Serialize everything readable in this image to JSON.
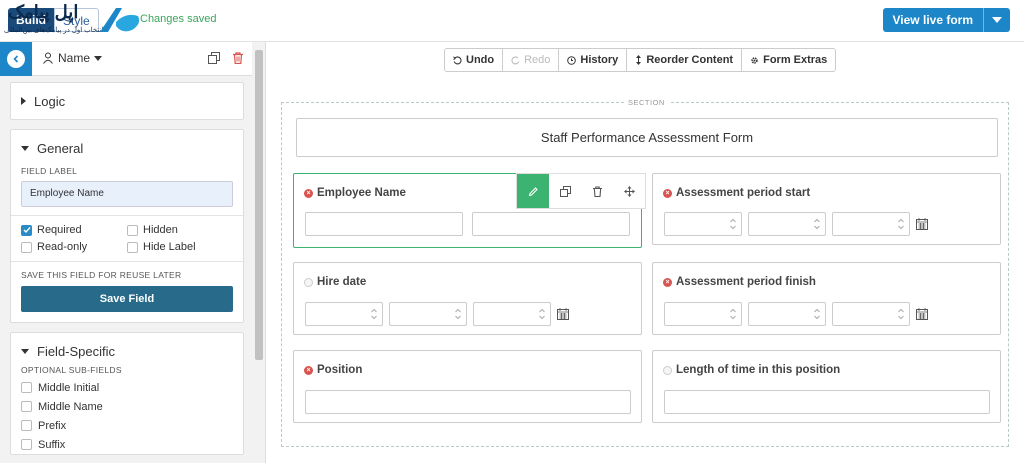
{
  "topbar": {
    "build_label": "Build",
    "style_label": "Style",
    "saved_text": "Changes saved",
    "watermark_text": "اپل پیامک",
    "watermark_subtext": "انتخاب اول در پیامک‌های بین‌المللی",
    "view_live_label": "View live form"
  },
  "panel": {
    "field_name_label": "Name",
    "logic_title": "Logic",
    "general_title": "General",
    "field_label_caption": "FIELD LABEL",
    "field_label_value": "Employee Name",
    "checks": [
      {
        "label": "Required",
        "checked": true
      },
      {
        "label": "Hidden",
        "checked": false
      },
      {
        "label": "Read-only",
        "checked": false
      },
      {
        "label": "Hide Label",
        "checked": false
      }
    ],
    "save_caption": "SAVE THIS FIELD FOR REUSE LATER",
    "save_button": "Save Field",
    "field_specific_title": "Field-Specific",
    "optional_caption": "OPTIONAL SUB-FIELDS",
    "subfields": [
      "Middle Initial",
      "Middle Name",
      "Prefix",
      "Suffix"
    ]
  },
  "toolbar": {
    "undo": "Undo",
    "redo": "Redo",
    "history": "History",
    "reorder": "Reorder Content",
    "extras": "Form Extras"
  },
  "form": {
    "section_label": "SECTION",
    "title": "Staff Performance Assessment Form",
    "fields": {
      "employee_name": {
        "label": "Employee Name",
        "required": true
      },
      "period_start": {
        "label": "Assessment period start",
        "required": true
      },
      "hire_date": {
        "label": "Hire date",
        "required": false
      },
      "period_finish": {
        "label": "Assessment period finish",
        "required": true
      },
      "position": {
        "label": "Position",
        "required": true
      },
      "length_time": {
        "label": "Length of time in this position",
        "required": false
      }
    }
  },
  "colors": {
    "accent_blue": "#1c86c8",
    "active_green": "#3cb371",
    "save_button": "#276a8a",
    "required_red": "#d9534f"
  },
  "icons": [
    "back-icon",
    "person-icon",
    "copy-icon",
    "trash-icon",
    "undo-icon",
    "redo-icon",
    "history-icon",
    "reorder-icon",
    "gear-icon",
    "pencil-icon",
    "move-icon",
    "calendar-icon"
  ]
}
